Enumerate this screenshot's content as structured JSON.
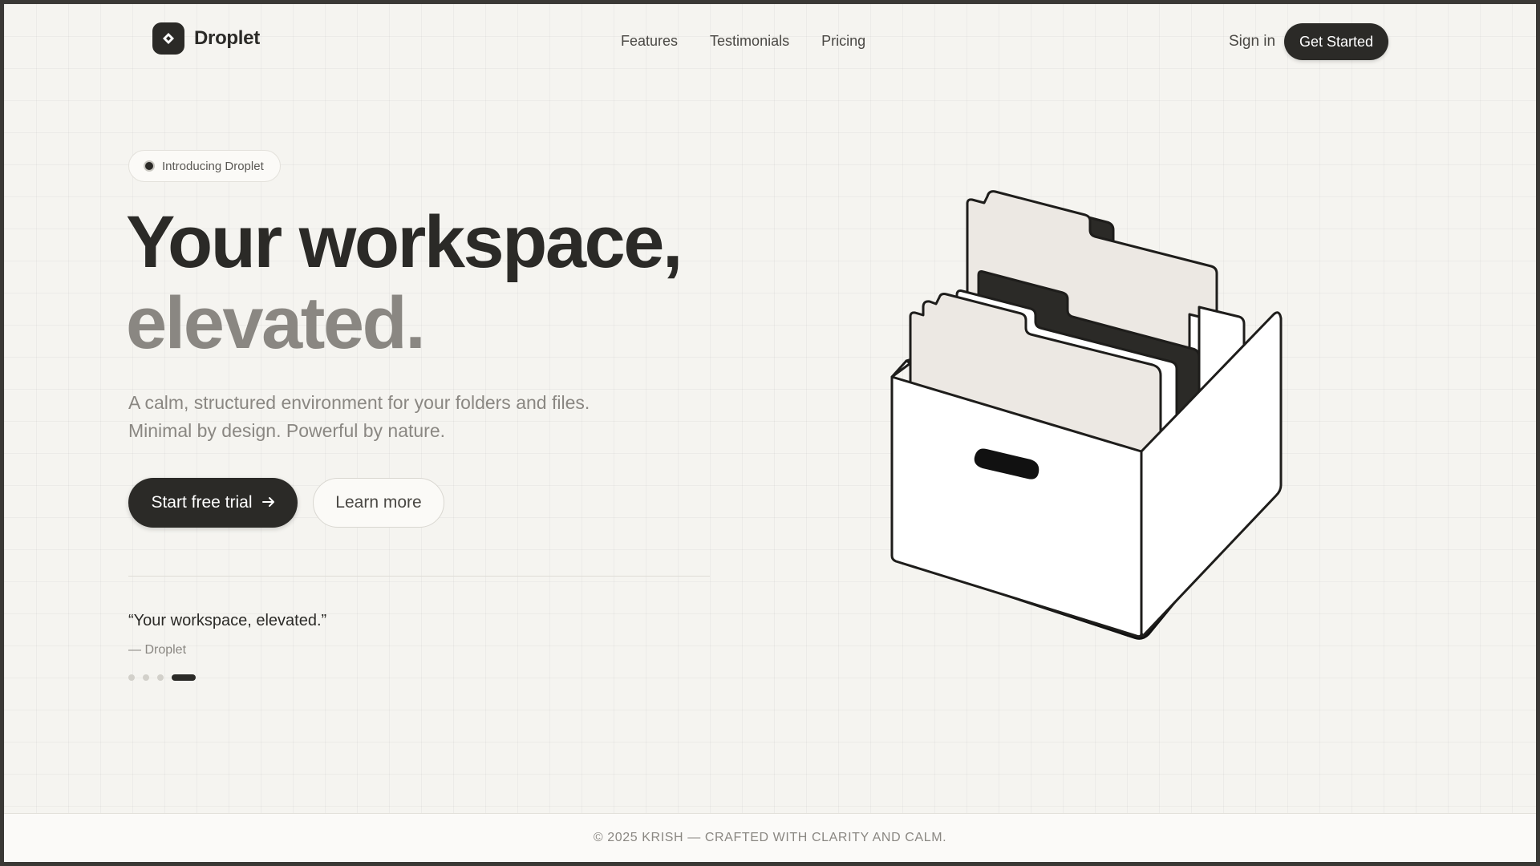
{
  "brand": {
    "name": "Droplet",
    "logo_icon": "diamond-icon"
  },
  "nav": {
    "links": [
      "Features",
      "Testimonials",
      "Pricing"
    ],
    "sign_in": "Sign in",
    "cta": "Get Started"
  },
  "hero": {
    "badge": "Introducing Droplet",
    "headline_line1": "Your workspace,",
    "headline_line2": "elevated.",
    "subtitle_line1": "A calm, structured environment for your folders and files.",
    "subtitle_line2": "Minimal by design. Powerful by nature.",
    "primary_button": "Start free trial",
    "primary_button_icon": "arrow-right-icon",
    "secondary_button": "Learn more"
  },
  "testimonial": {
    "quote": "“Your workspace, elevated.”",
    "author": "— Droplet",
    "slide_count": 4,
    "active_slide": 4
  },
  "illustration": {
    "icon": "file-box-illustration"
  },
  "footer": {
    "text": "© 2025 KRISH — CRAFTED WITH CLARITY AND CALM."
  },
  "colors": {
    "dark": "#2b2a27",
    "muted": "#8a8782",
    "background": "#f5f4f0"
  }
}
